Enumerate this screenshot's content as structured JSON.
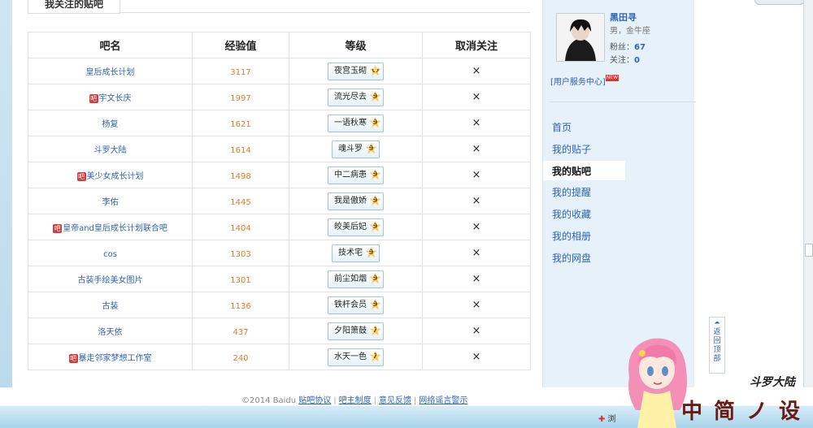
{
  "tab": {
    "label": "我关注的贴吧"
  },
  "table": {
    "headers": [
      "吧名",
      "经验值",
      "等级",
      "取消关注"
    ],
    "rows": [
      {
        "name": "皇后成长计划",
        "tag": false,
        "exp": "3117",
        "level": "夜宫玉砌",
        "lv": "11"
      },
      {
        "name": "宇文长庆",
        "tag": true,
        "exp": "1997",
        "level": "流光尽去",
        "lv": "9"
      },
      {
        "name": "杨复",
        "tag": false,
        "exp": "1621",
        "level": "一语秋寒",
        "lv": "9"
      },
      {
        "name": "斗罗大陆",
        "tag": false,
        "exp": "1614",
        "level": "魂斗罗",
        "lv": "9"
      },
      {
        "name": "美少女成长计划",
        "tag": true,
        "exp": "1498",
        "level": "中二病患",
        "lv": "9"
      },
      {
        "name": "李佑",
        "tag": false,
        "exp": "1445",
        "level": "我是傲娇",
        "lv": "9"
      },
      {
        "name": "皇帝and皇后成长计划联合吧",
        "tag": true,
        "exp": "1404",
        "level": "皎美后妃",
        "lv": "9"
      },
      {
        "name": "cos",
        "tag": false,
        "exp": "1303",
        "level": "技术宅",
        "lv": "9"
      },
      {
        "name": "古装手绘美女图片",
        "tag": false,
        "exp": "1301",
        "level": "前尘如烟",
        "lv": "9"
      },
      {
        "name": "古装",
        "tag": false,
        "exp": "1136",
        "level": "铁杆会员",
        "lv": "9"
      },
      {
        "name": "洛天依",
        "tag": false,
        "exp": "437",
        "level": "夕阳箫鼓",
        "lv": "7"
      },
      {
        "name": "暴走邻家梦想工作室",
        "tag": true,
        "exp": "240",
        "level": "水天一色",
        "lv": "7"
      }
    ],
    "cancel_symbol": "×",
    "tag_symbol": "吧"
  },
  "user": {
    "name": "黑田寻",
    "info": "男，金牛座",
    "fans_label": "粉丝：",
    "fans": "67",
    "follow_label": "关注：",
    "follow": "0",
    "service_link": "[用户服务中心]",
    "new_badge": "NEW"
  },
  "nav": [
    {
      "label": "首页",
      "active": false
    },
    {
      "label": "我的贴子",
      "active": false
    },
    {
      "label": "我的贴吧",
      "active": true
    },
    {
      "label": "我的提醒",
      "active": false
    },
    {
      "label": "我的收藏",
      "active": false
    },
    {
      "label": "我的相册",
      "active": false
    },
    {
      "label": "我的网盘",
      "active": false
    }
  ],
  "back_top": "返回顶部",
  "footer": {
    "copyright": "©2014 Baidu",
    "links": [
      "贴吧协议",
      "吧主制度",
      "意见反馈",
      "网络谣言警示"
    ]
  },
  "decor": {
    "big_text": "中简ノ设",
    "logo": "斗罗大陆"
  },
  "browser_button": "浏"
}
